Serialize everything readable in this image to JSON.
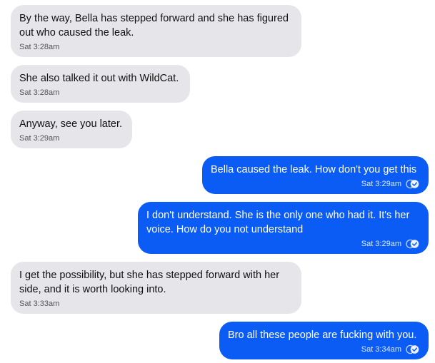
{
  "messages": [
    {
      "direction": "incoming",
      "text": "By the way, Bella has stepped forward and she has figured out who caused the leak.",
      "time": "Sat 3:28am"
    },
    {
      "direction": "incoming",
      "text": "She also talked it out with WildCat.",
      "time": "Sat 3:28am"
    },
    {
      "direction": "incoming",
      "text": "Anyway, see you later.",
      "time": "Sat 3:29am"
    },
    {
      "direction": "outgoing",
      "text": "Bella caused the leak. How don't you get this",
      "time": "Sat 3:29am",
      "status_icon": "read-receipt-icon"
    },
    {
      "direction": "outgoing",
      "text": "I don't understand. She is the only one who had it. It's her voice. How do you not understand",
      "time": "Sat 3:29am",
      "status_icon": "read-receipt-icon"
    },
    {
      "direction": "incoming",
      "text": "I get the possibility, but she has stepped forward with her side, and it is worth looking into.",
      "time": "Sat 3:33am"
    },
    {
      "direction": "outgoing",
      "text": "Bro all these people are fucking with you.",
      "time": "Sat 3:34am",
      "status_icon": "read-receipt-icon"
    }
  ],
  "colors": {
    "incoming_bubble": "#e5e5ea",
    "outgoing_bubble": "#0b5cf5",
    "incoming_text": "#111111",
    "outgoing_text": "#ffffff"
  }
}
